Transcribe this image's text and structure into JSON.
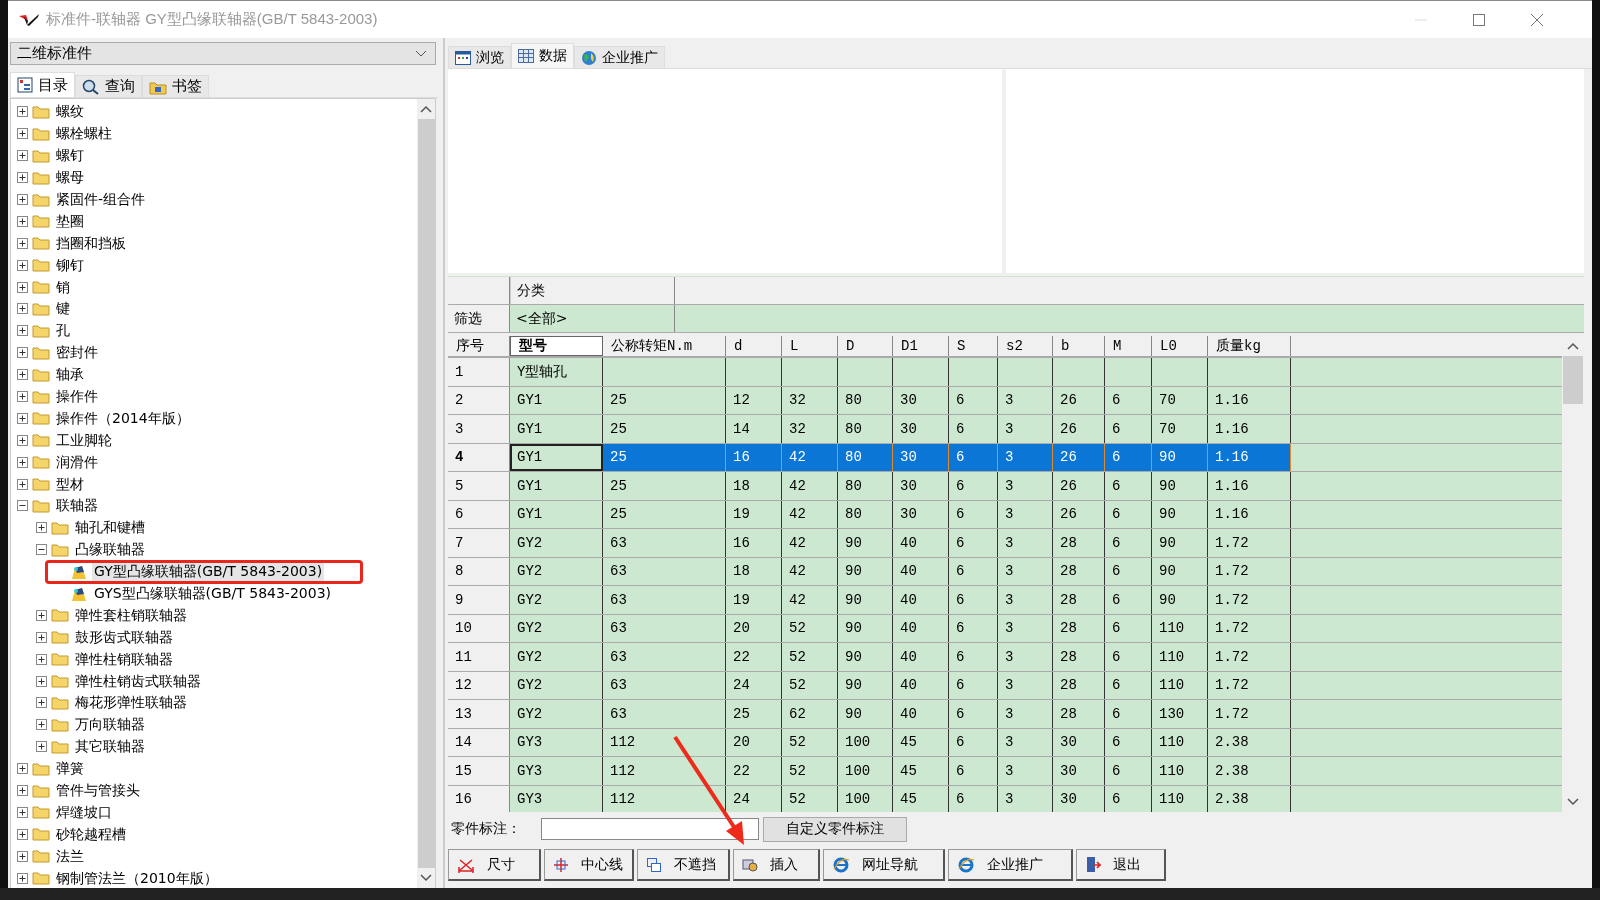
{
  "window": {
    "title": "标准件-联轴器 GY型凸缘联轴器(GB/T 5843-2003)"
  },
  "library_select": {
    "value": "二维标准件"
  },
  "left_tabs": [
    {
      "label": "目录",
      "selected": true
    },
    {
      "label": "查询",
      "selected": false
    },
    {
      "label": "书签",
      "selected": false
    }
  ],
  "tree": {
    "items": [
      {
        "label": "螺纹",
        "kind": "folder",
        "expanded": false,
        "selected": false
      },
      {
        "label": "螺栓螺柱",
        "kind": "folder",
        "expanded": false,
        "selected": false
      },
      {
        "label": "螺钉",
        "kind": "folder",
        "expanded": false,
        "selected": false
      },
      {
        "label": "螺母",
        "kind": "folder",
        "expanded": false,
        "selected": false
      },
      {
        "label": "紧固件-组合件",
        "kind": "folder",
        "expanded": false,
        "selected": false
      },
      {
        "label": "垫圈",
        "kind": "folder",
        "expanded": false,
        "selected": false
      },
      {
        "label": "挡圈和挡板",
        "kind": "folder",
        "expanded": false,
        "selected": false
      },
      {
        "label": "铆钉",
        "kind": "folder",
        "expanded": false,
        "selected": false
      },
      {
        "label": "销",
        "kind": "folder",
        "expanded": false,
        "selected": false
      },
      {
        "label": "键",
        "kind": "folder",
        "expanded": false,
        "selected": false
      },
      {
        "label": "孔",
        "kind": "folder",
        "expanded": false,
        "selected": false
      },
      {
        "label": "密封件",
        "kind": "folder",
        "expanded": false,
        "selected": false
      },
      {
        "label": "轴承",
        "kind": "folder",
        "expanded": false,
        "selected": false
      },
      {
        "label": "操作件",
        "kind": "folder",
        "expanded": false,
        "selected": false
      },
      {
        "label": "操作件（2014年版）",
        "kind": "folder",
        "expanded": false,
        "selected": false
      },
      {
        "label": "工业脚轮",
        "kind": "folder",
        "expanded": false,
        "selected": false
      },
      {
        "label": "润滑件",
        "kind": "folder",
        "expanded": false,
        "selected": false
      },
      {
        "label": "型材",
        "kind": "folder",
        "expanded": false,
        "selected": false
      },
      {
        "label": "联轴器",
        "kind": "folder",
        "expanded": true,
        "selected": false,
        "children": [
          {
            "label": "轴孔和键槽",
            "kind": "folder",
            "expanded": false,
            "selected": false
          },
          {
            "label": "凸缘联轴器",
            "kind": "folder",
            "expanded": true,
            "selected": false,
            "children": [
              {
                "label": "GY型凸缘联轴器(GB/T 5843-2003)",
                "kind": "part",
                "selected": true
              },
              {
                "label": "GYS型凸缘联轴器(GB/T 5843-2003)",
                "kind": "part",
                "selected": false
              }
            ]
          },
          {
            "label": "弹性套柱销联轴器",
            "kind": "folder",
            "expanded": false,
            "selected": false
          },
          {
            "label": "鼓形齿式联轴器",
            "kind": "folder",
            "expanded": false,
            "selected": false
          },
          {
            "label": "弹性柱销联轴器",
            "kind": "folder",
            "expanded": false,
            "selected": false
          },
          {
            "label": "弹性柱销齿式联轴器",
            "kind": "folder",
            "expanded": false,
            "selected": false
          },
          {
            "label": "梅花形弹性联轴器",
            "kind": "folder",
            "expanded": false,
            "selected": false
          },
          {
            "label": "万向联轴器",
            "kind": "folder",
            "expanded": false,
            "selected": false
          },
          {
            "label": "其它联轴器",
            "kind": "folder",
            "expanded": false,
            "selected": false
          }
        ]
      },
      {
        "label": "弹簧",
        "kind": "folder",
        "expanded": false,
        "selected": false
      },
      {
        "label": "管件与管接头",
        "kind": "folder",
        "expanded": false,
        "selected": false
      },
      {
        "label": "焊缝坡口",
        "kind": "folder",
        "expanded": false,
        "selected": false
      },
      {
        "label": "砂轮越程槽",
        "kind": "folder",
        "expanded": false,
        "selected": false
      },
      {
        "label": "法兰",
        "kind": "folder",
        "expanded": false,
        "selected": false
      },
      {
        "label": "钢制管法兰（2010年版）",
        "kind": "folder",
        "expanded": false,
        "selected": false
      }
    ]
  },
  "right_tabs": [
    {
      "label": "浏览",
      "selected": false
    },
    {
      "label": "数据",
      "selected": true
    },
    {
      "label": "企业推广",
      "selected": false
    }
  ],
  "filter": {
    "header": "分类",
    "label": "筛选",
    "value": "<全部>"
  },
  "table": {
    "columns": [
      "序号",
      "型号",
      "公称转矩N.m",
      "d",
      "L",
      "D",
      "D1",
      "S",
      "s2",
      "b",
      "M",
      "L0",
      "质量kg"
    ],
    "rows": [
      {
        "cells": [
          "1",
          "Y型轴孔"
        ],
        "selected": false
      },
      {
        "cells": [
          "2",
          "GY1",
          "25",
          "12",
          "32",
          "80",
          "30",
          "6",
          "3",
          "26",
          "6",
          "70",
          "1.16"
        ],
        "selected": false
      },
      {
        "cells": [
          "3",
          "GY1",
          "25",
          "14",
          "32",
          "80",
          "30",
          "6",
          "3",
          "26",
          "6",
          "70",
          "1.16"
        ],
        "selected": false
      },
      {
        "cells": [
          "4",
          "GY1",
          "25",
          "16",
          "42",
          "80",
          "30",
          "6",
          "3",
          "26",
          "6",
          "90",
          "1.16"
        ],
        "selected": true
      },
      {
        "cells": [
          "5",
          "GY1",
          "25",
          "18",
          "42",
          "80",
          "30",
          "6",
          "3",
          "26",
          "6",
          "90",
          "1.16"
        ],
        "selected": false
      },
      {
        "cells": [
          "6",
          "GY1",
          "25",
          "19",
          "42",
          "80",
          "30",
          "6",
          "3",
          "26",
          "6",
          "90",
          "1.16"
        ],
        "selected": false
      },
      {
        "cells": [
          "7",
          "GY2",
          "63",
          "16",
          "42",
          "90",
          "40",
          "6",
          "3",
          "28",
          "6",
          "90",
          "1.72"
        ],
        "selected": false
      },
      {
        "cells": [
          "8",
          "GY2",
          "63",
          "18",
          "42",
          "90",
          "40",
          "6",
          "3",
          "28",
          "6",
          "90",
          "1.72"
        ],
        "selected": false
      },
      {
        "cells": [
          "9",
          "GY2",
          "63",
          "19",
          "42",
          "90",
          "40",
          "6",
          "3",
          "28",
          "6",
          "90",
          "1.72"
        ],
        "selected": false
      },
      {
        "cells": [
          "10",
          "GY2",
          "63",
          "20",
          "52",
          "90",
          "40",
          "6",
          "3",
          "28",
          "6",
          "110",
          "1.72"
        ],
        "selected": false
      },
      {
        "cells": [
          "11",
          "GY2",
          "63",
          "22",
          "52",
          "90",
          "40",
          "6",
          "3",
          "28",
          "6",
          "110",
          "1.72"
        ],
        "selected": false
      },
      {
        "cells": [
          "12",
          "GY2",
          "63",
          "24",
          "52",
          "90",
          "40",
          "6",
          "3",
          "28",
          "6",
          "110",
          "1.72"
        ],
        "selected": false
      },
      {
        "cells": [
          "13",
          "GY2",
          "63",
          "25",
          "62",
          "90",
          "40",
          "6",
          "3",
          "28",
          "6",
          "130",
          "1.72"
        ],
        "selected": false
      },
      {
        "cells": [
          "14",
          "GY3",
          "112",
          "20",
          "52",
          "100",
          "45",
          "6",
          "3",
          "30",
          "6",
          "110",
          "2.38"
        ],
        "selected": false
      },
      {
        "cells": [
          "15",
          "GY3",
          "112",
          "22",
          "52",
          "100",
          "45",
          "6",
          "3",
          "30",
          "6",
          "110",
          "2.38"
        ],
        "selected": false
      },
      {
        "cells": [
          "16",
          "GY3",
          "112",
          "24",
          "52",
          "100",
          "45",
          "6",
          "3",
          "30",
          "6",
          "110",
          "2.38"
        ],
        "selected": false
      }
    ]
  },
  "part_label": {
    "label": "零件标注：",
    "custom_button": "自定义零件标注"
  },
  "buttons": [
    "尺寸",
    "中心线",
    "不遮挡",
    "插入",
    "网址导航",
    "企业推广",
    "退出"
  ]
}
